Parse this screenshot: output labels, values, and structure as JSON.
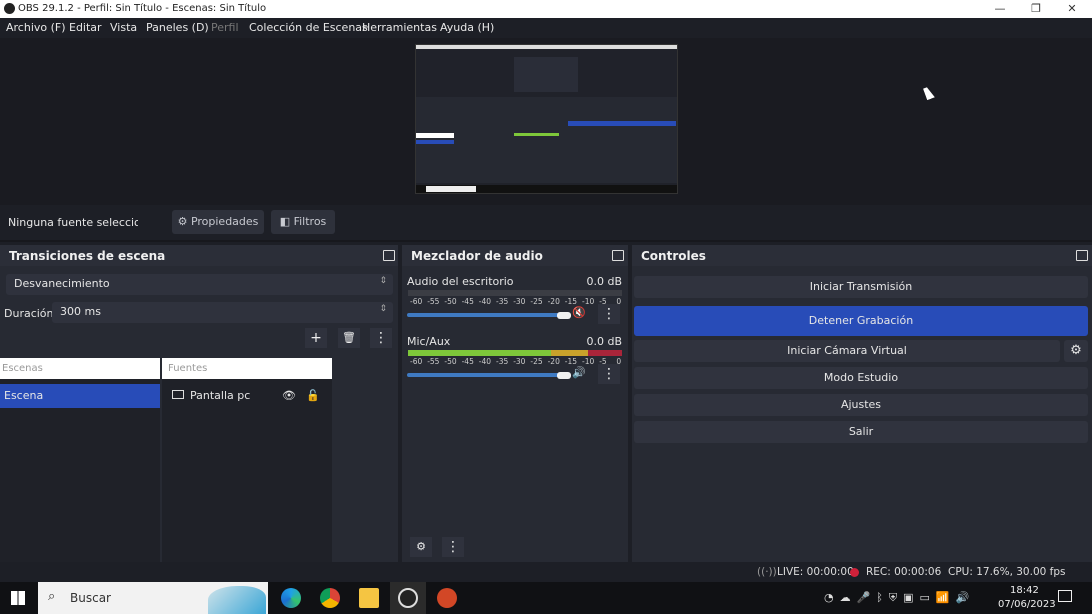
{
  "window": {
    "title": "OBS 29.1.2 - Perfil: Sin Título - Escenas: Sin Título",
    "minimize": "—",
    "maximize": "❐",
    "close": "✕"
  },
  "menu": [
    "Archivo (F)",
    "Editar",
    "Vista",
    "Paneles (D)",
    "Perfil",
    "Colección de Escenas",
    "Herramientas",
    "Ayuda (H)"
  ],
  "source_bar": {
    "status": "Ninguna fuente selecciona",
    "properties": "Propiedades",
    "filters": "Filtros"
  },
  "transitions": {
    "title": "Transiciones de escena",
    "selected": "Desvanecimiento",
    "duration_label": "Duración",
    "duration_value": "300 ms"
  },
  "scenes": {
    "header": "Escenas",
    "items": [
      "Escena"
    ]
  },
  "sources": {
    "header": "Fuentes",
    "items": [
      "Pantalla pc"
    ]
  },
  "mixer": {
    "title": "Mezclador de audio",
    "scale": [
      "-60",
      "-55",
      "-50",
      "-45",
      "-40",
      "-35",
      "-30",
      "-25",
      "-20",
      "-15",
      "-10",
      "-5",
      "0"
    ],
    "tracks": [
      {
        "name": "Audio del escritorio",
        "db": "0.0 dB",
        "muted": true,
        "volume": 1.0
      },
      {
        "name": "Mic/Aux",
        "db": "0.0 dB",
        "muted": false,
        "volume": 1.0,
        "level_db": -5
      }
    ]
  },
  "controls": {
    "title": "Controles",
    "buttons": [
      "Iniciar Transmisión",
      "Detener Grabación",
      "Iniciar Cámara Virtual",
      "Modo Estudio",
      "Ajustes",
      "Salir"
    ]
  },
  "status": {
    "live": "LIVE: 00:00:00",
    "rec": "REC: 00:00:06",
    "cpu": "CPU: 17.6%, 30.00 fps"
  },
  "taskbar": {
    "search": "Buscar",
    "time": "18:42",
    "date": "07/06/2023"
  },
  "colors": {
    "accent": "#284cb8",
    "rec": "#d0213a",
    "meter_green": "#7ec73a",
    "meter_yellow": "#c9a22b",
    "meter_red": "#a9253a"
  }
}
